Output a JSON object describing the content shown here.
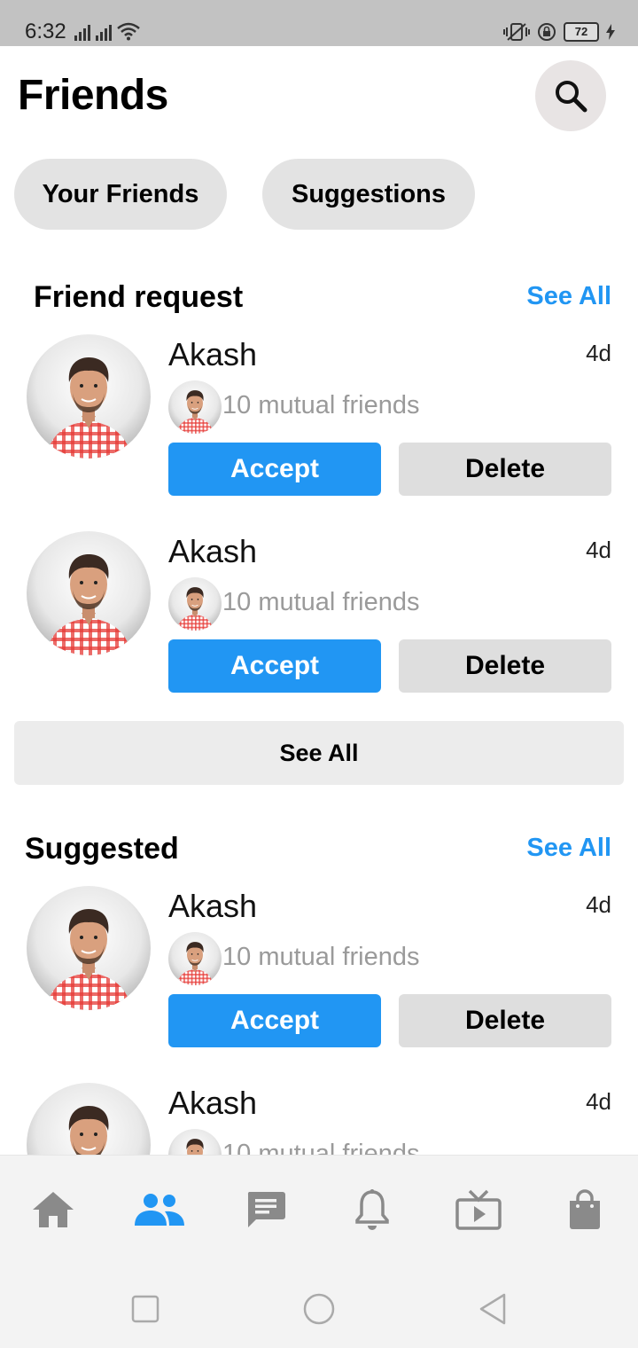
{
  "status_bar": {
    "time": "6:32",
    "battery": "72"
  },
  "header": {
    "title": "Friends"
  },
  "tabs": [
    {
      "label": "Your Friends"
    },
    {
      "label": "Suggestions"
    }
  ],
  "friend_requests": {
    "title": "Friend request",
    "see_all_label": "See All",
    "items": [
      {
        "name": "Akash",
        "time": "4d",
        "mutual": "10 mutual friends",
        "accept_label": "Accept",
        "delete_label": "Delete"
      },
      {
        "name": "Akash",
        "time": "4d",
        "mutual": "10 mutual friends",
        "accept_label": "Accept",
        "delete_label": "Delete"
      }
    ],
    "see_all_button_label": "See All"
  },
  "suggested": {
    "title": "Suggested",
    "see_all_label": "See All",
    "items": [
      {
        "name": "Akash",
        "time": "4d",
        "mutual": "10 mutual friends",
        "accept_label": "Accept",
        "delete_label": "Delete"
      },
      {
        "name": "Akash",
        "time": "4d",
        "mutual": "10 mutual friends"
      }
    ]
  },
  "bottom_nav": [
    {
      "icon": "home-icon",
      "active": false
    },
    {
      "icon": "friends-icon",
      "active": true
    },
    {
      "icon": "chat-icon",
      "active": false
    },
    {
      "icon": "bell-icon",
      "active": false
    },
    {
      "icon": "video-icon",
      "active": false
    },
    {
      "icon": "shopping-bag-icon",
      "active": false
    }
  ],
  "colors": {
    "accent": "#2196f3",
    "nav_inactive": "#8a8a8a",
    "pill_bg": "#e3e3e3"
  }
}
